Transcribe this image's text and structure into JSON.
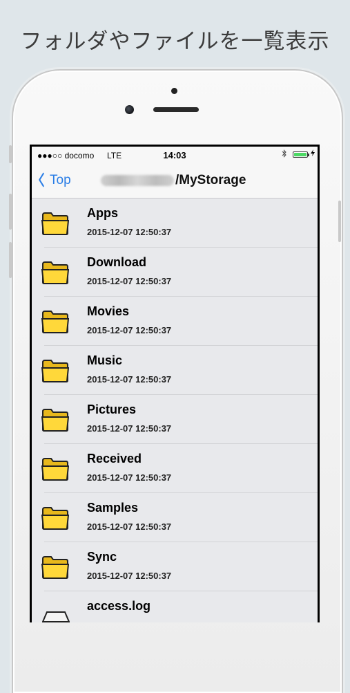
{
  "caption": "フォルダやファイルを一覧表示",
  "status_bar": {
    "carrier": "●●●○○ docomo",
    "network": "LTE",
    "time": "14:03",
    "bluetooth_icon": "bluetooth-icon",
    "battery_icon": "battery-charging-icon",
    "battery_color": "#4cd964"
  },
  "navbar": {
    "back_label": "Top",
    "title_suffix": "/MyStorage",
    "accent": "#2b7ee6"
  },
  "items": [
    {
      "name": "Apps",
      "date": "2015-12-07 12:50:37",
      "type": "folder",
      "icon": "folder-icon"
    },
    {
      "name": "Download",
      "date": "2015-12-07 12:50:37",
      "type": "folder",
      "icon": "folder-icon"
    },
    {
      "name": "Movies",
      "date": "2015-12-07 12:50:37",
      "type": "folder",
      "icon": "folder-icon"
    },
    {
      "name": "Music",
      "date": "2015-12-07 12:50:37",
      "type": "folder",
      "icon": "folder-icon"
    },
    {
      "name": "Pictures",
      "date": "2015-12-07 12:50:37",
      "type": "folder",
      "icon": "folder-icon"
    },
    {
      "name": "Received",
      "date": "2015-12-07 12:50:37",
      "type": "folder",
      "icon": "folder-icon"
    },
    {
      "name": "Samples",
      "date": "2015-12-07 12:50:37",
      "type": "folder",
      "icon": "folder-icon"
    },
    {
      "name": "Sync",
      "date": "2015-12-07 12:50:37",
      "type": "folder",
      "icon": "folder-icon"
    },
    {
      "name": "access.log",
      "date": "",
      "size": "",
      "type": "file",
      "icon": "file-icon"
    }
  ]
}
